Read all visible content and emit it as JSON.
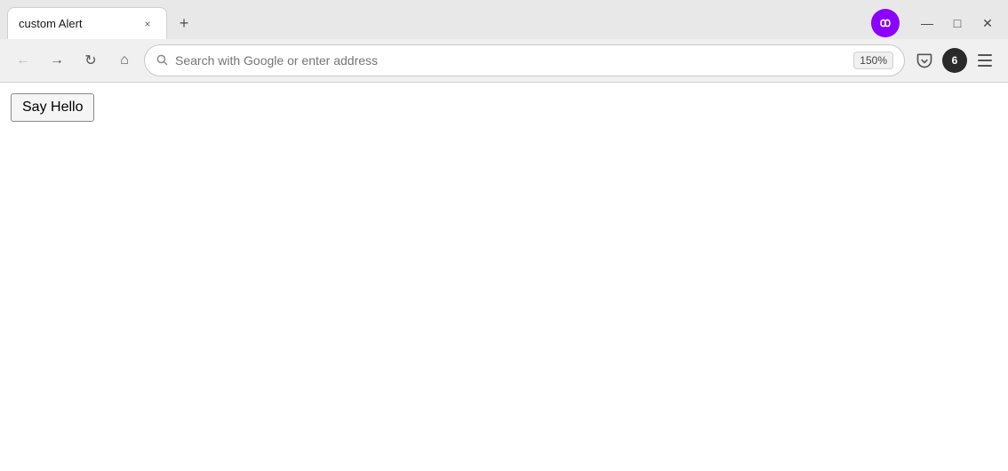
{
  "browser": {
    "tab": {
      "title": "custom Alert",
      "close_label": "×"
    },
    "new_tab_label": "+",
    "window_controls": {
      "minimize": "—",
      "maximize": "□",
      "close": "✕"
    },
    "nav": {
      "back_label": "←",
      "forward_label": "→",
      "reload_label": "↻",
      "home_label": "⌂",
      "address_placeholder": "Search with Google or enter address",
      "zoom_level": "150%"
    },
    "right_icons": {
      "pocket_label": "☆",
      "extensions_count": "6",
      "menu_label": "☰"
    }
  },
  "page": {
    "button_label": "Say Hello"
  },
  "colors": {
    "brand_purple": "#8b00ff",
    "tab_bg": "#ffffff",
    "chrome_bg": "#f0f0f0"
  }
}
